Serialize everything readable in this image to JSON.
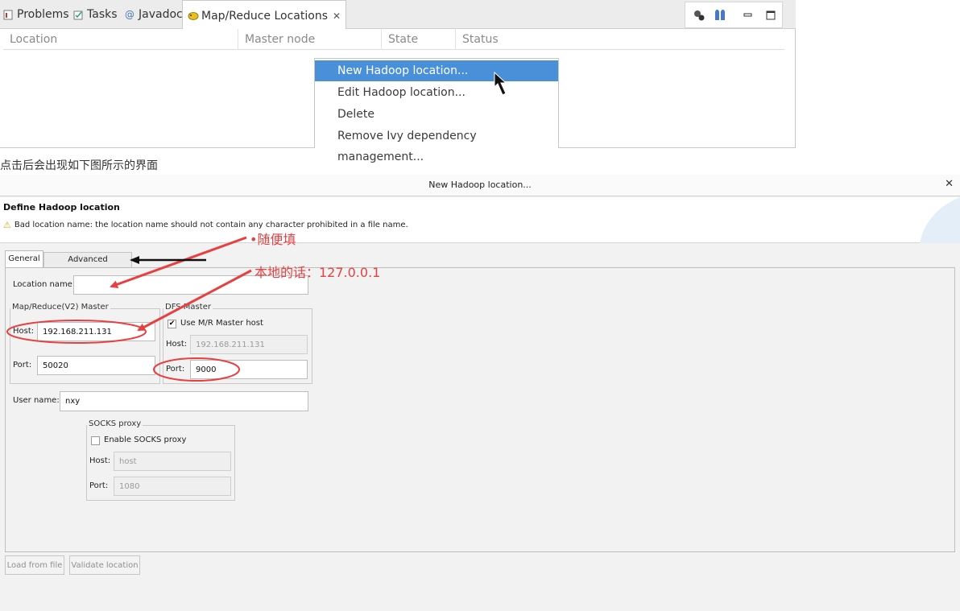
{
  "top_panel": {
    "tabs": [
      {
        "label": "Problems",
        "icon": "problems-icon"
      },
      {
        "label": "Tasks",
        "icon": "tasks-icon"
      },
      {
        "label": "Javadoc",
        "icon": "javadoc-icon"
      },
      {
        "label": "Map/Reduce Locations",
        "icon": "mapreduce-elephant-icon",
        "active": true
      }
    ],
    "columns": [
      "Location",
      "Master node",
      "State",
      "Status"
    ],
    "context_menu": [
      {
        "label": "New Hadoop location...",
        "selected": true
      },
      {
        "label": "Edit Hadoop location..."
      },
      {
        "label": "Delete"
      },
      {
        "label": "Remove Ivy dependency management..."
      }
    ],
    "accent": "#4a90d9"
  },
  "caption": "点击后会出现如下图所示的界面",
  "dialog": {
    "title": "New Hadoop location...",
    "heading": "Define Hadoop location",
    "warning": "Bad location name: the location name should not contain any character prohibited in a file name.",
    "tabs": {
      "general": "General",
      "advanced": "Advanced parameters"
    },
    "location_name": {
      "label": "Location name:",
      "value": ""
    },
    "mr_master": {
      "title": "Map/Reduce(V2) Master",
      "host_label": "Host:",
      "host": "192.168.211.131",
      "port_label": "Port:",
      "port": "50020"
    },
    "dfs_master": {
      "title": "DFS Master",
      "use_mr_label": "Use M/R Master host",
      "use_mr_checked": true,
      "host_label": "Host:",
      "host": "192.168.211.131",
      "port_label": "Port:",
      "port": "9000"
    },
    "user_name": {
      "label": "User name:",
      "value": "nxy"
    },
    "socks": {
      "title": "SOCKS proxy",
      "enable_label": "Enable SOCKS proxy",
      "enabled": false,
      "host_label": "Host:",
      "host_placeholder": "host",
      "port_label": "Port:",
      "port_placeholder": "1080"
    },
    "buttons": {
      "load": "Load from file",
      "validate": "Validate location"
    }
  },
  "annotations": {
    "note1": "•随便填",
    "note2": "本地的话：127.0.0.1",
    "color": "#e84040"
  }
}
